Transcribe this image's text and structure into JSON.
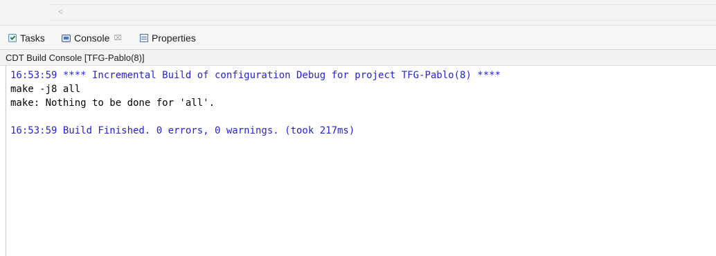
{
  "scrollbar": {
    "left_arrow": "<"
  },
  "tabs": [
    {
      "label": "Tasks",
      "icon": "tasks-icon"
    },
    {
      "label": "Console",
      "icon": "console-icon",
      "close": "⌧"
    },
    {
      "label": "Properties",
      "icon": "properties-icon"
    }
  ],
  "console": {
    "title": "CDT Build Console [TFG-Pablo(8)]",
    "lines": [
      {
        "text": "16:53:59 **** Incremental Build of configuration Debug for project TFG-Pablo(8) ****",
        "kind": "info"
      },
      {
        "text": "make -j8 all",
        "kind": "normal"
      },
      {
        "text": "make: Nothing to be done for 'all'.",
        "kind": "normal"
      },
      {
        "text": "",
        "kind": "normal"
      },
      {
        "text": "16:53:59 Build Finished. 0 errors, 0 warnings. (took 217ms)",
        "kind": "info"
      }
    ]
  },
  "colors": {
    "info_text": "#2323d8",
    "normal_text": "#000000"
  }
}
